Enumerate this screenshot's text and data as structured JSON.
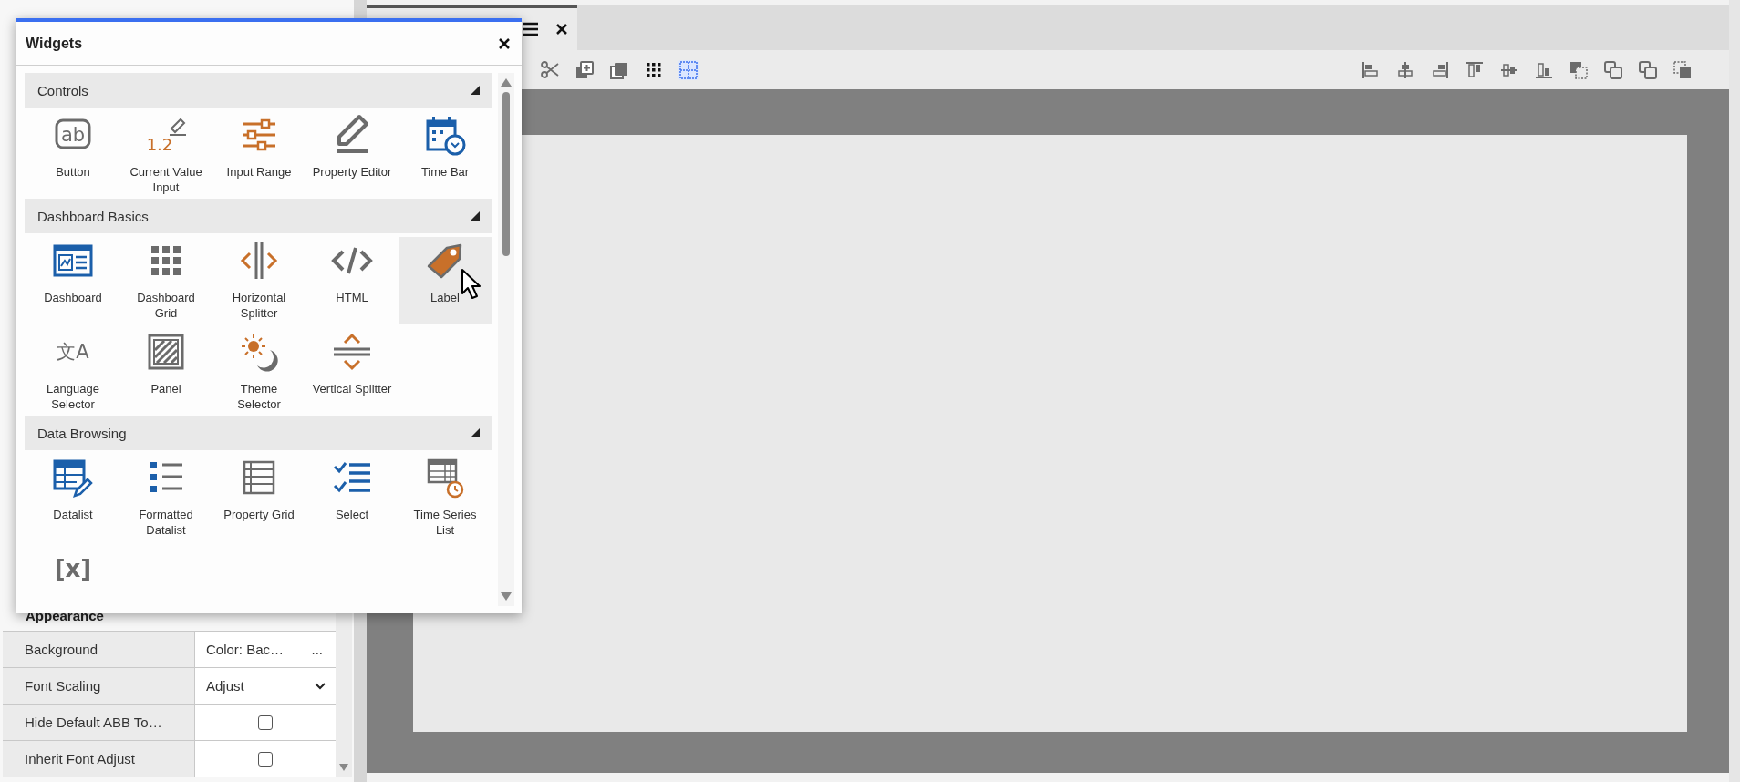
{
  "dialog": {
    "title": "Widgets",
    "sections": [
      {
        "title": "Controls",
        "expanded": true,
        "items": [
          {
            "label": "Button",
            "glyph": "ab",
            "hovered": false
          },
          {
            "label": "Current Value Input",
            "glyph": "1.2",
            "hovered": false
          },
          {
            "label": "Input Range",
            "hovered": false
          },
          {
            "label": "Property Editor",
            "hovered": false
          },
          {
            "label": "Time Bar",
            "hovered": false
          }
        ]
      },
      {
        "title": "Dashboard Basics",
        "expanded": true,
        "items": [
          {
            "label": "Dashboard",
            "hovered": false
          },
          {
            "label": "Dashboard Grid",
            "hovered": false
          },
          {
            "label": "Horizontal Splitter",
            "hovered": false
          },
          {
            "label": "HTML",
            "hovered": false
          },
          {
            "label": "Label",
            "hovered": true
          },
          {
            "label": "Language Selector",
            "glyph": "文A",
            "hovered": false
          },
          {
            "label": "Panel",
            "hovered": false
          },
          {
            "label": "Theme Selector",
            "hovered": false
          },
          {
            "label": "Vertical Splitter",
            "hovered": false
          }
        ]
      },
      {
        "title": "Data Browsing",
        "expanded": true,
        "items": [
          {
            "label": "Datalist",
            "hovered": false
          },
          {
            "label": "Formatted Datalist",
            "hovered": false
          },
          {
            "label": "Property Grid",
            "hovered": false
          },
          {
            "label": "Select",
            "hovered": false
          },
          {
            "label": "Time Series List",
            "hovered": false
          },
          {
            "glyph": "[x]",
            "hovered": false
          }
        ]
      }
    ]
  },
  "toolbar": {
    "tools": [
      {
        "on": false
      },
      {
        "on": false
      },
      {
        "on": false
      },
      {
        "on": false
      },
      {
        "on": true
      }
    ]
  },
  "properties": {
    "group": "Appearance",
    "rows": [
      {
        "name": "Background",
        "kind": "color",
        "value": "Color: Bac…",
        "button": "..."
      },
      {
        "name": "Font Scaling",
        "kind": "dropdown",
        "value": "Adjust"
      },
      {
        "name": "Hide Default ABB To…",
        "kind": "checkbox",
        "checked": false
      },
      {
        "name": "Inherit Font Adjust",
        "kind": "checkbox",
        "checked": false
      }
    ]
  }
}
